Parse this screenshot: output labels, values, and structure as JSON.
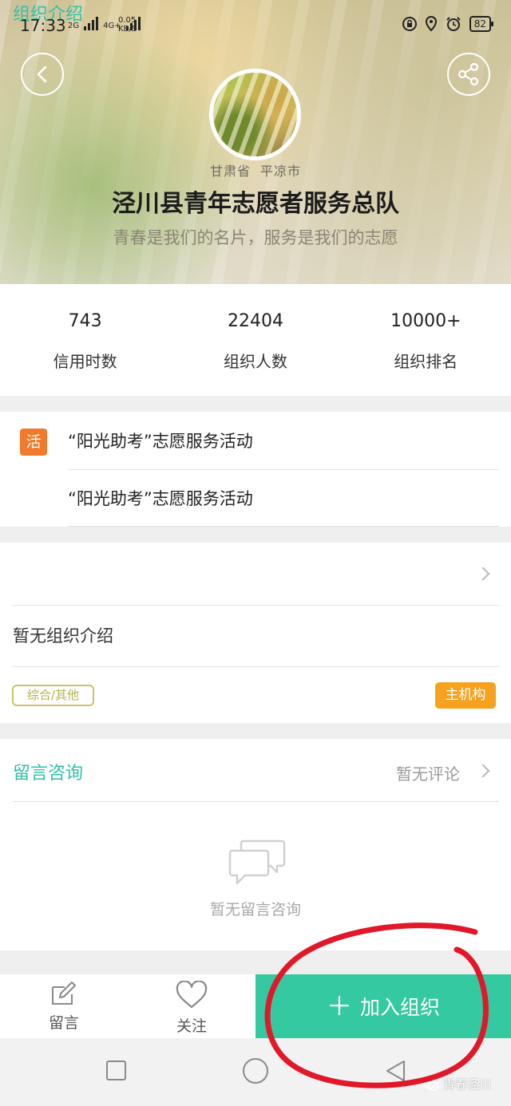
{
  "status_bar": {
    "time": "17:33",
    "net1": "2G",
    "net2": "4G+",
    "speed_value": "0.05",
    "speed_unit": "KB/S",
    "battery": "82"
  },
  "header": {
    "province": "甘肃省",
    "city": "平凉市",
    "org_name": "泾川县青年志愿者服务总队",
    "slogan": "青春是我们的名片，服务是我们的志愿"
  },
  "stats": [
    {
      "value": "743",
      "label": "信用时数"
    },
    {
      "value": "22404",
      "label": "组织人数"
    },
    {
      "value": "10000+",
      "label": "组织排名"
    }
  ],
  "activities": {
    "badge": "活",
    "items": [
      "“阳光助考”志愿服务活动",
      "“阳光助考”志愿服务活动"
    ]
  },
  "intro": {
    "title": "组织介绍",
    "text": "暂无组织介绍",
    "tag_type": "综合/其他",
    "tag_main": "主机构"
  },
  "comments": {
    "title": "留言咨询",
    "status": "暂无评论",
    "empty_text": "暂无留言咨询"
  },
  "bottom_bar": {
    "message_label": "留言",
    "follow_label": "关注",
    "join_label": "加入组织",
    "join_plus": "＋"
  },
  "watermark": "青春泾川",
  "colors": {
    "accent": "#2ec2a6",
    "join": "#34c9a0",
    "activity_badge": "#f27a2c",
    "main_tag": "#f6a21e",
    "annotation": "#e0182a"
  }
}
